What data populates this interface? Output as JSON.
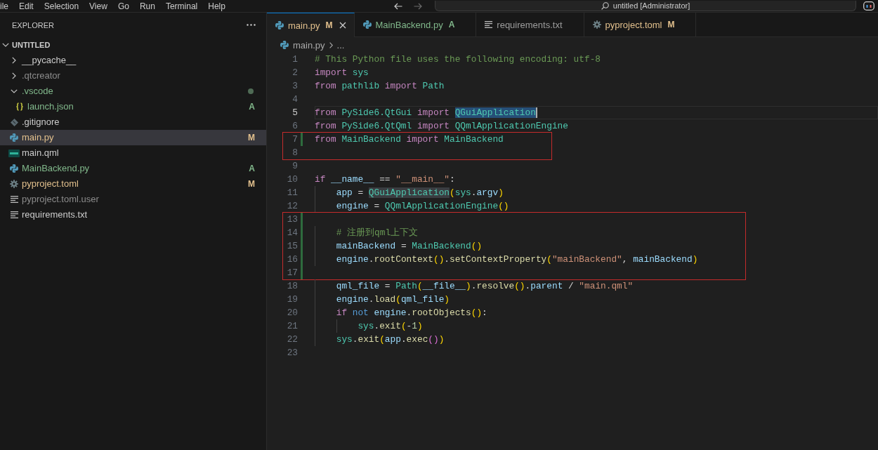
{
  "title_bar": {
    "menu": [
      "ile",
      "Edit",
      "Selection",
      "View",
      "Go",
      "Run",
      "Terminal",
      "Help"
    ],
    "command_center": {
      "value": "untitled [Administrator]"
    }
  },
  "explorer": {
    "title": "EXPLORER",
    "tree": [
      {
        "label": "UNTITLED",
        "kind": "folder",
        "expanded": true,
        "selected": false,
        "dot": false,
        "children": [
          {
            "label": "__pycache__",
            "kind": "folder",
            "expanded": false,
            "selected": false,
            "color": "#cccccc",
            "dot": false
          },
          {
            "label": ".qtcreator",
            "kind": "folder",
            "expanded": false,
            "selected": false,
            "color": "#8c8c8c",
            "dot": false
          },
          {
            "label": ".vscode",
            "kind": "folder",
            "expanded": true,
            "selected": false,
            "color": "#81b88b",
            "dot": true,
            "children": [
              {
                "label": "launch.json",
                "kind": "json",
                "selected": false,
                "color": "#81b88b",
                "dot": false,
                "badge": "A"
              }
            ]
          },
          {
            "label": ".gitignore",
            "kind": "git",
            "selected": false,
            "color": "#cccccc",
            "dot": false
          },
          {
            "label": "main.py",
            "kind": "python",
            "selected": true,
            "color": "#e2c08d",
            "dot": false,
            "badge": "M"
          },
          {
            "label": "main.qml",
            "kind": "qml",
            "selected": false,
            "color": "#cccccc",
            "dot": false
          },
          {
            "label": "MainBackend.py",
            "kind": "python",
            "selected": false,
            "color": "#81b88b",
            "dot": false,
            "badge": "A"
          },
          {
            "label": "pyproject.toml",
            "kind": "gear",
            "selected": false,
            "color": "#e2c08d",
            "dot": false,
            "badge": "M"
          },
          {
            "label": "pyproject.toml.user",
            "kind": "text",
            "selected": false,
            "color": "#8c8c8c",
            "dot": false
          },
          {
            "label": "requirements.txt",
            "kind": "text",
            "selected": false,
            "color": "#cccccc",
            "dot": false
          }
        ]
      }
    ]
  },
  "tabs": [
    {
      "label": "main.py",
      "kind": "python",
      "badge": "M",
      "color": "#e2c08d",
      "selected": true
    },
    {
      "label": "MainBackend.py",
      "kind": "python",
      "badge": "A",
      "color": "#81b88b",
      "selected": false
    },
    {
      "label": "requirements.txt",
      "kind": "text",
      "color": "#9d9d9d",
      "selected": false
    },
    {
      "label": "pyproject.toml",
      "kind": "gear",
      "badge": "M",
      "color": "#e2c08d",
      "selected": false
    }
  ],
  "breadcrumb": [
    {
      "label": "main.py",
      "kind": "python"
    },
    {
      "label": "...",
      "kind": "none"
    }
  ],
  "code": {
    "groups": [
      {
        "boxed": false,
        "lines": [
          {
            "n": "1",
            "current": false,
            "added": false,
            "tokens": [
              {
                "text": "# This Python file uses the following encoding: utf-8",
                "kind": "comment"
              }
            ]
          },
          {
            "n": "2",
            "current": false,
            "added": false,
            "tokens": [
              {
                "text": "import",
                "kind": "keyword"
              },
              {
                "text": " sys",
                "kind": "type"
              }
            ]
          },
          {
            "n": "3",
            "current": false,
            "added": false,
            "tokens": [
              {
                "text": "from",
                "kind": "keyword"
              },
              {
                "text": " pathlib",
                "kind": "type"
              },
              {
                "text": " import",
                "kind": "keyword"
              },
              {
                "text": " Path",
                "kind": "type"
              }
            ]
          },
          {
            "n": "4",
            "current": false,
            "added": false
          },
          {
            "n": "5",
            "current": true,
            "added": false,
            "tokens": [
              {
                "text": "from",
                "kind": "keyword"
              },
              {
                "text": " PySide6.QtGui",
                "kind": "type"
              },
              {
                "text": " import ",
                "kind": "keyword"
              },
              {
                "text": "QGuiApplication",
                "kind": "selection"
              }
            ]
          },
          {
            "n": "6",
            "current": false,
            "added": false,
            "tokens": [
              {
                "text": "from",
                "kind": "keyword"
              },
              {
                "text": " PySide6.QtQml",
                "kind": "type"
              },
              {
                "text": " import",
                "kind": "keyword"
              },
              {
                "text": " QQmlApplicationEngine",
                "kind": "type"
              }
            ]
          }
        ]
      },
      {
        "boxed": true,
        "lines": [
          {
            "n": "7",
            "current": false,
            "added": true,
            "tokens": [
              {
                "text": "from",
                "kind": "keyword"
              },
              {
                "text": " MainBackend",
                "kind": "type"
              },
              {
                "text": " import",
                "kind": "keyword"
              },
              {
                "text": " MainBackend",
                "kind": "type"
              }
            ]
          },
          {
            "n": "8",
            "current": false,
            "added": false
          }
        ]
      },
      {
        "boxed": false,
        "lines": [
          {
            "n": "9",
            "current": false,
            "added": false
          },
          {
            "n": "10",
            "current": false,
            "added": false,
            "tokens": [
              {
                "text": "if",
                "kind": "keyword"
              },
              {
                "text": " __name__",
                "kind": "variable"
              },
              {
                "text": " == ",
                "kind": "operator"
              },
              {
                "text": "\"__main__\"",
                "kind": "string"
              },
              {
                "text": ":",
                "kind": "operator"
              }
            ]
          },
          {
            "n": "11",
            "current": false,
            "added": false,
            "tokens": [
              {
                "text": "    app",
                "kind": "variable"
              },
              {
                "text": " = ",
                "kind": "operator"
              },
              {
                "text": "QGuiApplication",
                "kind": "occurrence"
              },
              {
                "text": "(",
                "kind": "bracket"
              },
              {
                "text": "sys",
                "kind": "type"
              },
              {
                "text": ".",
                "kind": "operator"
              },
              {
                "text": "argv",
                "kind": "variable"
              },
              {
                "text": ")",
                "kind": "bracket"
              }
            ]
          },
          {
            "n": "12",
            "current": false,
            "added": false,
            "tokens": [
              {
                "text": "    engine",
                "kind": "variable"
              },
              {
                "text": " = ",
                "kind": "operator"
              },
              {
                "text": "QQmlApplicationEngine",
                "kind": "type"
              },
              {
                "text": "()",
                "kind": "bracket"
              }
            ]
          }
        ]
      },
      {
        "boxed": true,
        "lines": [
          {
            "n": "13",
            "current": false,
            "added": true
          },
          {
            "n": "14",
            "current": false,
            "added": true,
            "tokens": [
              {
                "text": "    # 注册到qml上下文",
                "kind": "comment"
              }
            ]
          },
          {
            "n": "15",
            "current": false,
            "added": true,
            "tokens": [
              {
                "text": "    mainBackend",
                "kind": "variable"
              },
              {
                "text": " = ",
                "kind": "operator"
              },
              {
                "text": "MainBackend",
                "kind": "type"
              },
              {
                "text": "()",
                "kind": "bracket"
              }
            ]
          },
          {
            "n": "16",
            "current": false,
            "added": true,
            "tokens": [
              {
                "text": "    engine",
                "kind": "variable"
              },
              {
                "text": ".",
                "kind": "operator"
              },
              {
                "text": "rootContext",
                "kind": "function"
              },
              {
                "text": "()",
                "kind": "bracket"
              },
              {
                "text": ".",
                "kind": "operator"
              },
              {
                "text": "setContextProperty",
                "kind": "function"
              },
              {
                "text": "(",
                "kind": "bracket"
              },
              {
                "text": "\"mainBackend\"",
                "kind": "string"
              },
              {
                "text": ", ",
                "kind": "operator"
              },
              {
                "text": "mainBackend",
                "kind": "variable"
              },
              {
                "text": ")",
                "kind": "bracket"
              }
            ]
          },
          {
            "n": "17",
            "current": false,
            "added": true
          }
        ]
      },
      {
        "boxed": false,
        "lines": [
          {
            "n": "18",
            "current": false,
            "added": false,
            "tokens": [
              {
                "text": "    qml_file",
                "kind": "variable"
              },
              {
                "text": " = ",
                "kind": "operator"
              },
              {
                "text": "Path",
                "kind": "type"
              },
              {
                "text": "(",
                "kind": "bracket"
              },
              {
                "text": "__file__",
                "kind": "variable"
              },
              {
                "text": ")",
                "kind": "bracket"
              },
              {
                "text": ".",
                "kind": "operator"
              },
              {
                "text": "resolve",
                "kind": "function"
              },
              {
                "text": "()",
                "kind": "bracket"
              },
              {
                "text": ".",
                "kind": "operator"
              },
              {
                "text": "parent",
                "kind": "variable"
              },
              {
                "text": " / ",
                "kind": "operator"
              },
              {
                "text": "\"main.qml\"",
                "kind": "string"
              }
            ]
          },
          {
            "n": "19",
            "current": false,
            "added": false,
            "tokens": [
              {
                "text": "    engine",
                "kind": "variable"
              },
              {
                "text": ".",
                "kind": "operator"
              },
              {
                "text": "load",
                "kind": "function"
              },
              {
                "text": "(",
                "kind": "bracket"
              },
              {
                "text": "qml_file",
                "kind": "variable"
              },
              {
                "text": ")",
                "kind": "bracket"
              }
            ]
          },
          {
            "n": "20",
            "current": false,
            "added": false,
            "tokens": [
              {
                "text": "    if",
                "kind": "keyword"
              },
              {
                "text": " not",
                "kind": "operator_word"
              },
              {
                "text": " engine",
                "kind": "variable"
              },
              {
                "text": ".",
                "kind": "operator"
              },
              {
                "text": "rootObjects",
                "kind": "function"
              },
              {
                "text": "()",
                "kind": "bracket"
              },
              {
                "text": ":",
                "kind": "operator"
              }
            ]
          },
          {
            "n": "21",
            "current": false,
            "added": false,
            "tokens": [
              {
                "text": "        sys",
                "kind": "type"
              },
              {
                "text": ".",
                "kind": "operator"
              },
              {
                "text": "exit",
                "kind": "function"
              },
              {
                "text": "(",
                "kind": "bracket"
              },
              {
                "text": "-",
                "kind": "operator"
              },
              {
                "text": "1",
                "kind": "number"
              },
              {
                "text": ")",
                "kind": "bracket"
              }
            ]
          },
          {
            "n": "22",
            "current": false,
            "added": false,
            "tokens": [
              {
                "text": "    sys",
                "kind": "type"
              },
              {
                "text": ".",
                "kind": "operator"
              },
              {
                "text": "exit",
                "kind": "function"
              },
              {
                "text": "(",
                "kind": "bracket"
              },
              {
                "text": "app",
                "kind": "variable"
              },
              {
                "text": ".",
                "kind": "operator"
              },
              {
                "text": "exec",
                "kind": "function"
              },
              {
                "text": "()",
                "kind": "bracket_inner"
              },
              {
                "text": ")",
                "kind": "bracket"
              }
            ]
          },
          {
            "n": "23",
            "current": false,
            "added": false
          }
        ]
      }
    ]
  }
}
